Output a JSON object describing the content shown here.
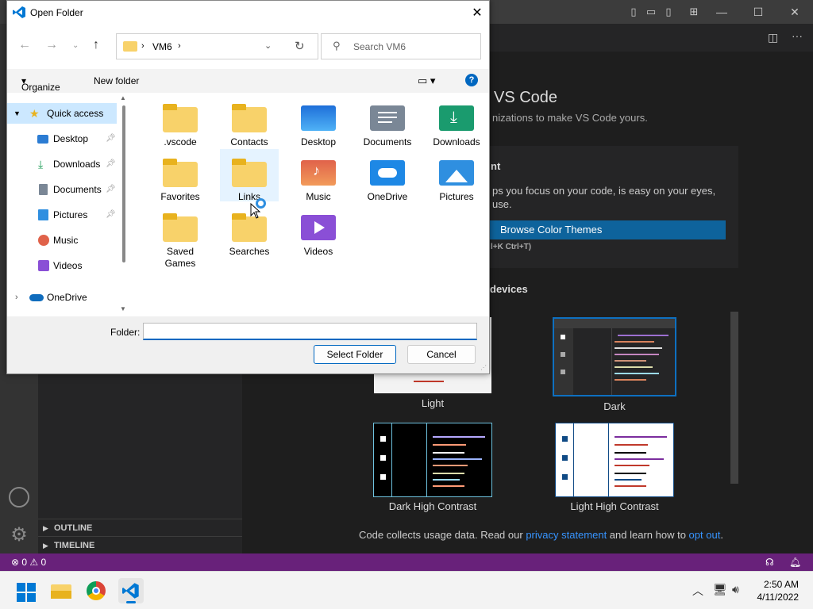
{
  "dialog": {
    "title": "Open Folder",
    "path_segment": "VM6",
    "search_placeholder": "Search VM6",
    "toolbar": {
      "organize": "Organize",
      "new_folder": "New folder"
    },
    "nav": [
      {
        "label": "Quick access",
        "icon": "star-icon"
      },
      {
        "label": "Desktop",
        "icon": "desktop-icon",
        "pinned": true
      },
      {
        "label": "Downloads",
        "icon": "download-icon",
        "pinned": true
      },
      {
        "label": "Documents",
        "icon": "documents-icon",
        "pinned": true
      },
      {
        "label": "Pictures",
        "icon": "pictures-icon",
        "pinned": true
      },
      {
        "label": "Music",
        "icon": "music-icon"
      },
      {
        "label": "Videos",
        "icon": "videos-icon"
      },
      {
        "label": "OneDrive",
        "icon": "onedrive-icon"
      }
    ],
    "items": [
      {
        "label": ".vscode",
        "kind": "folder"
      },
      {
        "label": "Contacts",
        "kind": "folder"
      },
      {
        "label": "Desktop",
        "kind": "desktop"
      },
      {
        "label": "Documents",
        "kind": "documents"
      },
      {
        "label": "Downloads",
        "kind": "downloads"
      },
      {
        "label": "Favorites",
        "kind": "folder"
      },
      {
        "label": "Links",
        "kind": "folder",
        "hover": true
      },
      {
        "label": "Music",
        "kind": "music"
      },
      {
        "label": "OneDrive",
        "kind": "onedrive"
      },
      {
        "label": "Pictures",
        "kind": "pictures"
      },
      {
        "label": "Saved Games",
        "kind": "folder"
      },
      {
        "label": "Searches",
        "kind": "folder"
      },
      {
        "label": "Videos",
        "kind": "videos"
      }
    ],
    "folder_label": "Folder:",
    "folder_value": "",
    "select_button": "Select Folder",
    "cancel_button": "Cancel"
  },
  "vscode": {
    "welcome_title": "VS Code",
    "welcome_sub": "nizations to make VS Code yours.",
    "card_title": "nt",
    "card_text": "ps you focus on your code, is easy on your eyes, use.",
    "browse_button": "Browse Color Themes",
    "shortcut": "l+K Ctrl+T)",
    "devices_heading": "devices",
    "themes": [
      {
        "label": "Light",
        "selected": false
      },
      {
        "label": "Dark",
        "selected": true
      },
      {
        "label": "Dark High Contrast",
        "selected": false
      },
      {
        "label": "Light High Contrast",
        "selected": false
      }
    ],
    "telemetry": {
      "pre": "Code collects usage data. Read our ",
      "link1": "privacy statement",
      "mid": " and learn how to ",
      "link2": "opt out",
      "post": "."
    },
    "sections": {
      "outline": "OUTLINE",
      "timeline": "TIMELINE"
    },
    "status": {
      "errors": "0",
      "warnings": "0"
    }
  },
  "taskbar": {
    "time": "2:50 AM",
    "date": "4/11/2022",
    "apps": [
      "windows-start-icon",
      "file-explorer-icon",
      "chrome-icon",
      "vscode-icon"
    ]
  },
  "colors": {
    "statusbar": "#68217a",
    "accent": "#0067c0",
    "folder_yellow": "#f8d26a"
  }
}
